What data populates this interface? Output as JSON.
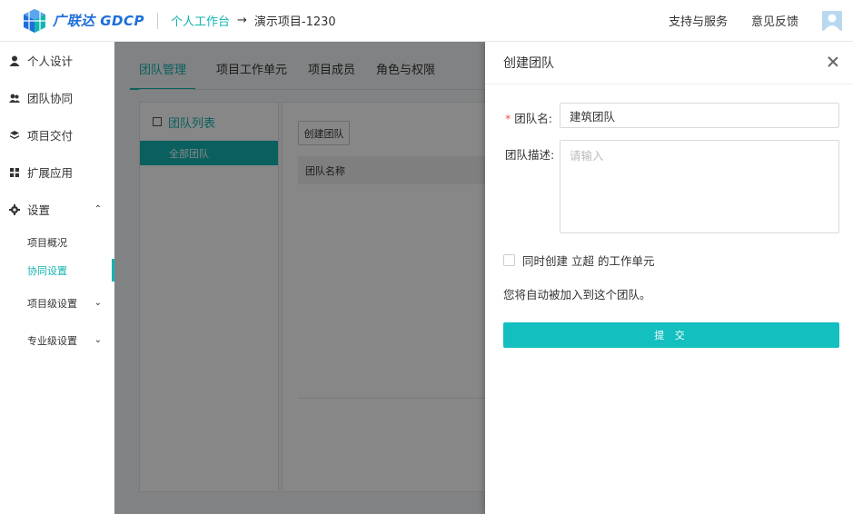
{
  "header": {
    "logo_text": "广联达 GDCP",
    "breadcrumb_home": "个人工作台",
    "breadcrumb_arrow": "→",
    "breadcrumb_current": "演示项目-1230",
    "support_label": "支持与服务",
    "feedback_label": "意见反馈"
  },
  "sidebar": {
    "items": [
      {
        "label": "个人设计",
        "icon": "user-icon"
      },
      {
        "label": "团队协同",
        "icon": "team-icon"
      },
      {
        "label": "项目交付",
        "icon": "layers-icon"
      },
      {
        "label": "扩展应用",
        "icon": "grid-icon"
      },
      {
        "label": "设置",
        "icon": "gear-icon"
      }
    ],
    "sub_items": [
      {
        "label": "项目概况"
      },
      {
        "label": "协同设置"
      },
      {
        "label": "项目级设置"
      },
      {
        "label": "专业级设置"
      }
    ]
  },
  "main": {
    "tabs": [
      "团队管理",
      "项目工作单元",
      "项目成员",
      "角色与权限"
    ],
    "team_list_title": "团队列表",
    "team_all": "全部团队",
    "create_team_button": "创建团队",
    "table_header": "团队名称"
  },
  "drawer": {
    "title": "创建团队",
    "team_name_label": "团队名",
    "team_name_value": "建筑团队",
    "team_desc_label": "团队描述",
    "team_desc_placeholder": "请输入",
    "checkbox_label": "同时创建 立超 的工作单元",
    "info_text": "您将自动被加入到这个团队。",
    "submit_label": "提 交",
    "required_mark": "*"
  },
  "colors": {
    "accent": "#13b5b1",
    "brand_blue": "#1e6fd9",
    "submit": "#13bfbf"
  }
}
